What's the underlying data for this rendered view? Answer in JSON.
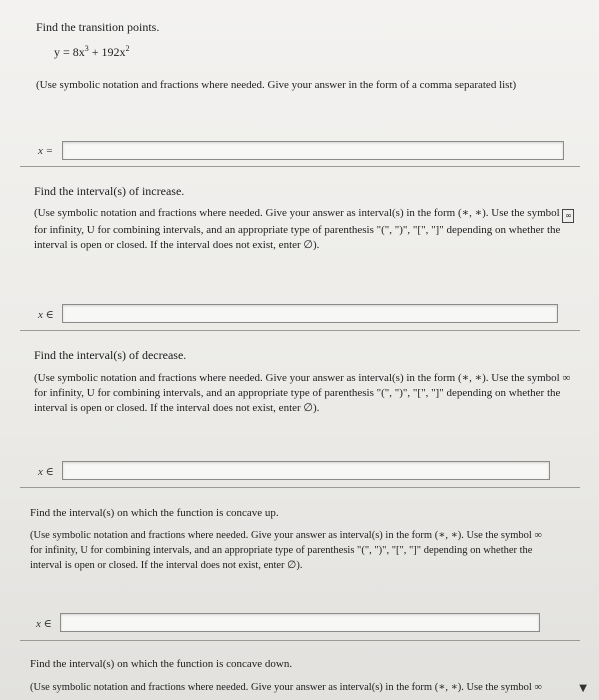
{
  "problem": {
    "title": "Find the transition points.",
    "equation": {
      "lhs": "y = 8x",
      "exp1": "3",
      "mid": " + 192x",
      "exp2": "2"
    },
    "instruction": "(Use symbolic notation and fractions where needed. Give your answer in the form of a comma separated list)",
    "var_label": "x ="
  },
  "sections": [
    {
      "title": "Find the interval(s) of increase.",
      "instruction_a": "(Use symbolic notation and fractions where needed. Give your answer as interval(s) in the form (∗, ∗). Use the symbol ",
      "instruction_b": "for infinity, U for combining intervals, and an appropriate type of parenthesis \"(\", \")\", \"[\", \"]\" depending on whether the",
      "instruction_c": "interval is open or closed. If the interval does not exist, enter ∅).",
      "var_label": "x ∈"
    },
    {
      "title": "Find the interval(s) of decrease.",
      "instruction_a": "(Use symbolic notation and fractions where needed. Give your answer as interval(s) in the form (∗, ∗). Use the symbol ∞",
      "instruction_b": "for infinity, U for combining intervals, and an appropriate type of parenthesis \"(\", \")\", \"[\", \"]\" depending on whether the",
      "instruction_c": "interval is open or closed. If the interval does not exist, enter ∅).",
      "var_label": "x ∈"
    },
    {
      "title": "Find the interval(s) on which the function is concave up.",
      "instruction_a": "(Use symbolic notation and fractions where needed. Give your answer as interval(s) in the form (∗, ∗). Use the symbol ∞",
      "instruction_b": "for infinity, U for combining intervals, and an appropriate type of parenthesis \"(\", \")\", \"[\", \"]\" depending on whether the",
      "instruction_c": "interval is open or closed. If the interval does not exist, enter ∅).",
      "var_label": "x ∈"
    },
    {
      "title": "Find the interval(s) on which the function is concave down.",
      "instruction_a": "(Use symbolic notation and fractions where needed. Give your answer as interval(s) in the form (∗, ∗). Use the symbol ∞"
    }
  ],
  "icons": {
    "infinity_button": "∞",
    "scroll_down": "▼"
  }
}
